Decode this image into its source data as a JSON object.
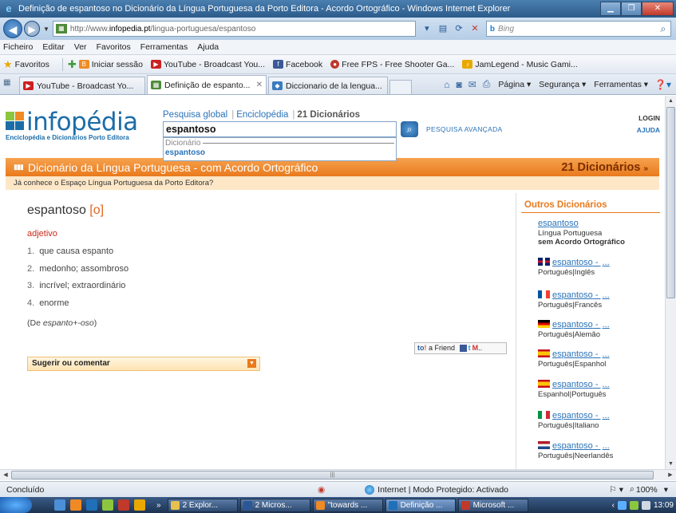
{
  "window": {
    "title": "Definição de espantoso no Dicionário da Língua Portuguesa da Porto Editora - Acordo Ortográfico - Windows Internet Explorer"
  },
  "address": {
    "url_prefix": "http://www.",
    "url_domain": "infopedia.pt",
    "url_path": "/lingua-portuguesa/espantoso",
    "search_placeholder": "Bing"
  },
  "menu": [
    "Ficheiro",
    "Editar",
    "Ver",
    "Favoritos",
    "Ferramentas",
    "Ajuda"
  ],
  "favorites": {
    "label": "Favoritos",
    "items": [
      {
        "label": "Iniciar sessão",
        "color": "#f08a24"
      },
      {
        "label": "YouTube - Broadcast You...",
        "color": "#cc2020"
      },
      {
        "label": "Facebook",
        "color": "#3b5998"
      },
      {
        "label": "Free FPS - Free Shooter Ga...",
        "color": "#c0392b"
      },
      {
        "label": "JamLegend - Music Gami...",
        "color": "#e8a800"
      }
    ]
  },
  "tabs": [
    {
      "label": "YouTube - Broadcast Yo...",
      "color": "#cc2020",
      "active": false
    },
    {
      "label": "Definição de espanto...",
      "color": "#4e8a3a",
      "active": true
    },
    {
      "label": "Diccionario de la lengua...",
      "color": "#3a7bbf",
      "active": false
    }
  ],
  "commands": {
    "page": "Página",
    "security": "Segurança",
    "tools": "Ferramentas"
  },
  "site": {
    "logo_text": "infopédia",
    "logo_tagline": "Enciclopédia e Dicionários Porto Editora",
    "search_tabs": [
      "Pesquisa global",
      "Enciclopédia",
      "21 Dicionários"
    ],
    "search_value": "espantoso",
    "advanced": "PESQUISA AVANÇADA",
    "login": "LOGIN",
    "help": "AJUDA",
    "suggest_header": "Dicionário",
    "suggest_item": "espantoso",
    "dict_title": "Dicionário da Língua Portuguesa - com Acordo Ortográfico",
    "dict_count": "21 Dicionários",
    "notice": "Já conhece o Espaço Língua Portuguesa da Porto Editora?"
  },
  "entry": {
    "word": "espantoso",
    "pron": "[o]",
    "pos": "adjetivo",
    "senses": [
      {
        "n": "1.",
        "text": "que causa espanto"
      },
      {
        "n": "2.",
        "text": "medonho; assombroso"
      },
      {
        "n": "3.",
        "text": "incrível; extraordinário"
      },
      {
        "n": "4.",
        "text": "enorme"
      }
    ],
    "etym_open": "(De ",
    "etym_word": "espanto+-oso",
    "etym_close": ")",
    "share_to": "to",
    "share_friend": "a Friend",
    "suggest_comment": "Sugerir ou comentar"
  },
  "others": {
    "title": "Outros Dicionários",
    "first": {
      "link": "espantoso",
      "lang": "Língua Portuguesa",
      "sub": "sem Acordo Ortográfico"
    },
    "items": [
      {
        "link": "espantoso",
        "dots": "...",
        "lang": "Português|Inglês",
        "flag": "uk"
      },
      {
        "link": "espantoso",
        "dots": "...",
        "lang": "Português|Francês",
        "flag": "fr"
      },
      {
        "link": "espantoso",
        "dots": "...",
        "lang": "Português|Alemão",
        "flag": "de"
      },
      {
        "link": "espantoso",
        "dots": "...",
        "lang": "Português|Espanhol",
        "flag": "es"
      },
      {
        "link": "espantoso",
        "dots": "...",
        "lang": "Espanhol|Português",
        "flag": "es"
      },
      {
        "link": "espantoso",
        "dots": "...",
        "lang": "Português|Italiano",
        "flag": "it"
      },
      {
        "link": "espantoso",
        "dots": "...",
        "lang": "Português|Neerlandês",
        "flag": "nl"
      }
    ]
  },
  "status": {
    "text": "Concluído",
    "zone": "Internet | Modo Protegido: Activado",
    "zoom": "100%"
  },
  "taskbar": {
    "items": [
      "2 Explor...",
      "2 Micros...",
      "\"towards ...",
      "Definição ...",
      "Microsoft ..."
    ],
    "clock": "13:09"
  }
}
